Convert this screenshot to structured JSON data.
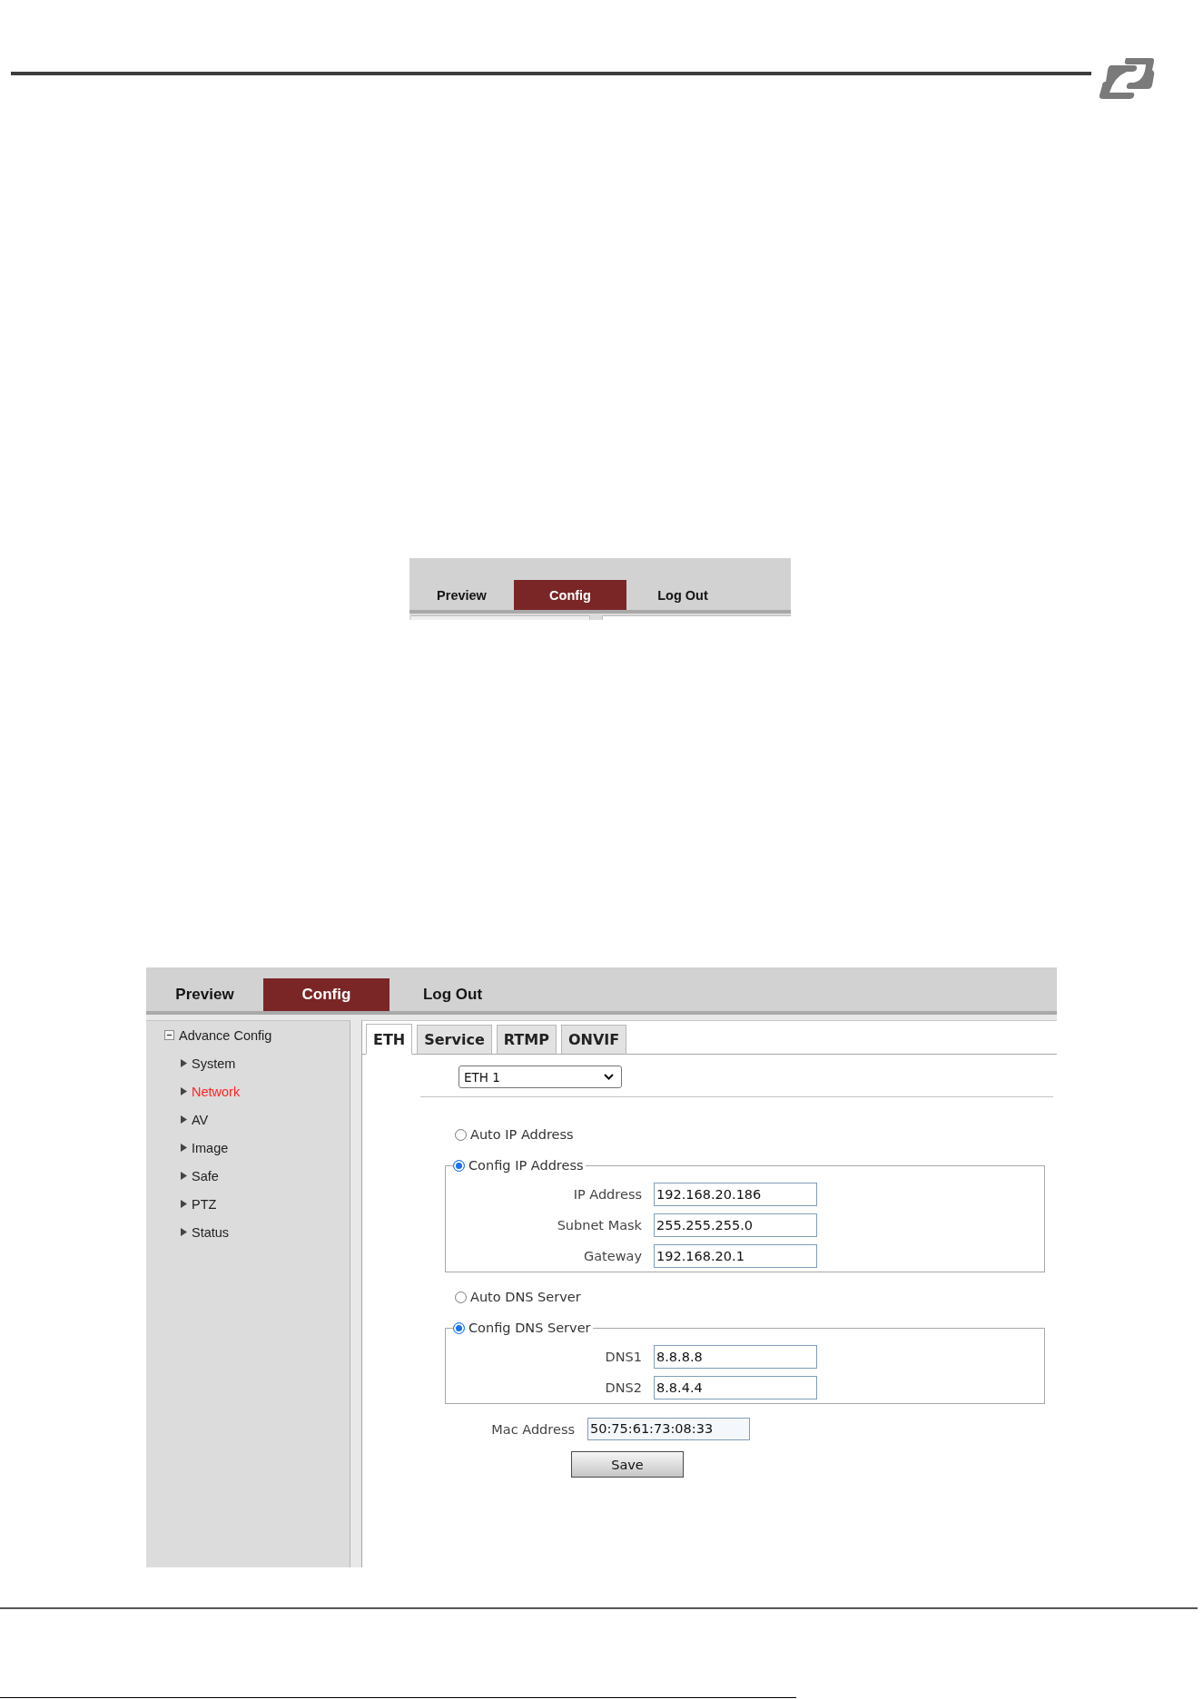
{
  "figure_1": {
    "nav_tabs": [
      {
        "label": "Preview",
        "selected": false
      },
      {
        "label": "Config",
        "selected": true
      },
      {
        "label": "Log Out",
        "selected": false
      }
    ]
  },
  "figure_2": {
    "nav_tabs": [
      {
        "label": "Preview",
        "selected": false
      },
      {
        "label": "Config",
        "selected": true
      },
      {
        "label": "Log Out",
        "selected": false
      }
    ],
    "sidebar": {
      "title": "Advance Config",
      "expanded": true,
      "items": [
        {
          "label": "System",
          "selected": false
        },
        {
          "label": "Network",
          "selected": true
        },
        {
          "label": "AV",
          "selected": false
        },
        {
          "label": "Image",
          "selected": false
        },
        {
          "label": "Safe",
          "selected": false
        },
        {
          "label": "PTZ",
          "selected": false
        },
        {
          "label": "Status",
          "selected": false
        }
      ]
    },
    "tabs": [
      {
        "label": "ETH",
        "selected": true
      },
      {
        "label": "Service",
        "selected": false
      },
      {
        "label": "RTMP",
        "selected": false
      },
      {
        "label": "ONVIF",
        "selected": false
      }
    ],
    "interface_select": {
      "value": "ETH 1"
    },
    "radio_groups": [
      {
        "options": [
          {
            "kind": "plain",
            "label": "Auto IP Address",
            "selected": false
          },
          {
            "kind": "fieldset",
            "label": "Config IP Address",
            "selected": true,
            "fields": [
              {
                "label": "IP Address",
                "value": "192.168.20.186"
              },
              {
                "label": "Subnet Mask",
                "value": "255.255.255.0"
              },
              {
                "label": "Gateway",
                "value": "192.168.20.1"
              }
            ]
          }
        ]
      },
      {
        "options": [
          {
            "kind": "plain",
            "label": "Auto DNS Server",
            "selected": false
          },
          {
            "kind": "fieldset",
            "label": "Config DNS Server",
            "selected": true,
            "fields": [
              {
                "label": "DNS1",
                "value": "8.8.8.8"
              },
              {
                "label": "DNS2",
                "value": "8.8.4.4"
              }
            ]
          }
        ]
      }
    ],
    "mac_address": {
      "label": "Mac Address",
      "value": "50:75:61:73:08:33"
    },
    "save_button": {
      "label": "Save"
    }
  }
}
